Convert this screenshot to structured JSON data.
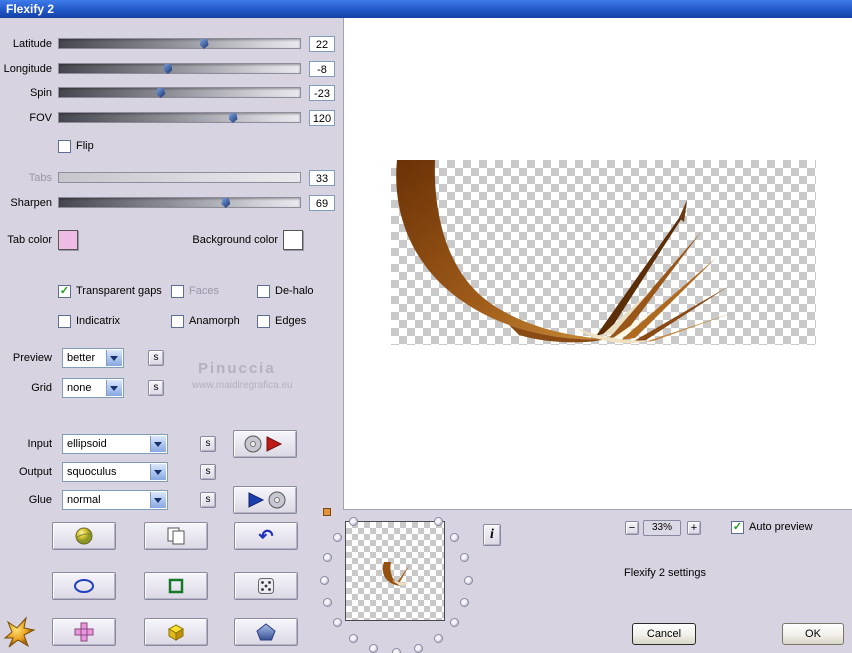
{
  "window": {
    "title": "Flexify 2"
  },
  "sliders": {
    "latitude": {
      "label": "Latitude",
      "value": "22"
    },
    "longitude": {
      "label": "Longitude",
      "value": "-8"
    },
    "spin": {
      "label": "Spin",
      "value": "-23"
    },
    "fov": {
      "label": "FOV",
      "value": "120"
    },
    "tabs": {
      "label": "Tabs",
      "value": "33"
    },
    "sharpen": {
      "label": "Sharpen",
      "value": "69"
    }
  },
  "checkboxes": {
    "flip": {
      "label": "Flip",
      "mark": ""
    },
    "transparent_gaps": {
      "label": "Transparent gaps",
      "mark": "✓"
    },
    "faces": {
      "label": "Faces",
      "mark": ""
    },
    "de_halo": {
      "label": "De-halo",
      "mark": ""
    },
    "indicatrix": {
      "label": "Indicatrix",
      "mark": ""
    },
    "anamorph": {
      "label": "Anamorph",
      "mark": ""
    },
    "edges": {
      "label": "Edges",
      "mark": ""
    },
    "auto_preview": {
      "label": "Auto preview",
      "mark": "✓"
    }
  },
  "color_pickers": {
    "tab_color": {
      "label": "Tab color",
      "color": "#eebbe4"
    },
    "background_color": {
      "label": "Background color",
      "color": "#ffffff"
    }
  },
  "dropdowns": {
    "preview": {
      "label": "Preview",
      "value": "better"
    },
    "grid": {
      "label": "Grid",
      "value": "none"
    },
    "input": {
      "label": "Input",
      "value": "ellipsoid"
    },
    "output": {
      "label": "Output",
      "value": "squoculus"
    },
    "glue": {
      "label": "Glue",
      "value": "normal"
    }
  },
  "seed_button_label": "s",
  "watermark": {
    "line1": "Pinuccia",
    "line2": "www.maidiregrafica.eu"
  },
  "info_button_label": "i",
  "zoom": {
    "minus_label": "−",
    "value": "33%",
    "plus_label": "+"
  },
  "status_text": "Flexify 2 settings",
  "action_buttons": {
    "cancel_label": "Cancel",
    "ok_label": "OK"
  },
  "icons": {
    "undo-icon": "↶",
    "planet-icon": "yellow-green sphere",
    "copy-icon": "two overlapping pages",
    "ellipse-icon": "blue ellipse outline",
    "square-icon": "green square outline",
    "dice-icon": "die face five",
    "unfold-cross-icon": "pink cross of squares",
    "box-icon": "yellow cube",
    "gem-icon": "blue pentagon",
    "flame-icon": "gold splat",
    "cd-export-icon": "disc with red arrow",
    "cd-import-icon": "blue arrow with disc",
    "chevron-down-icon": "combo arrow"
  }
}
